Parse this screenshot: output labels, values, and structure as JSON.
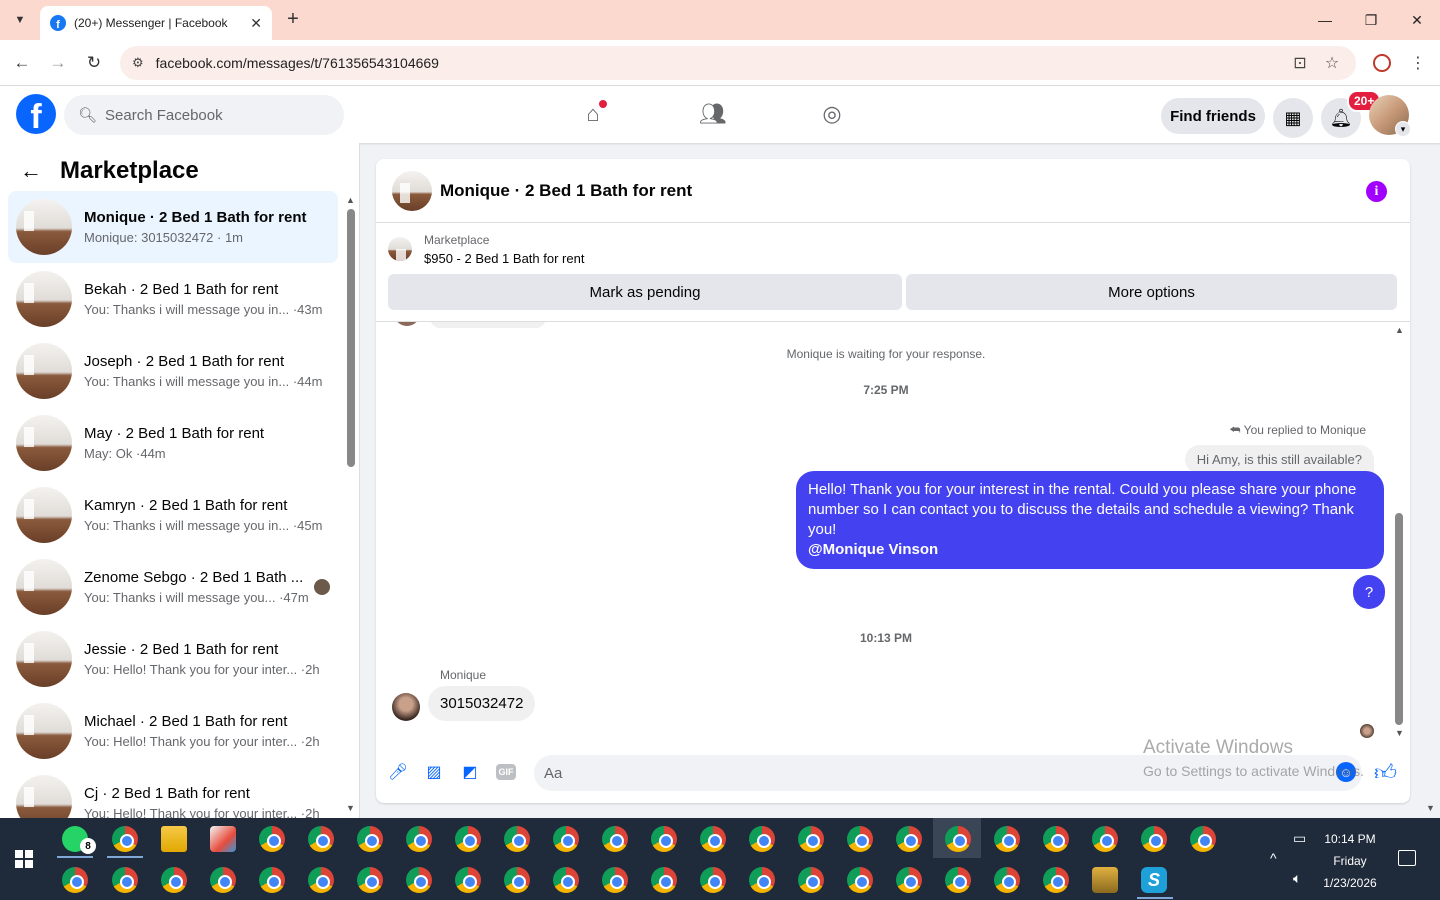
{
  "browser": {
    "tab_title": "(20+) Messenger | Facebook",
    "url": "facebook.com/messages/t/761356543104669"
  },
  "fb": {
    "search_placeholder": "Search Facebook",
    "find_friends": "Find friends",
    "notif_badge": "20+",
    "logo_letter": "f"
  },
  "sidebar": {
    "title": "Marketplace",
    "conversations": [
      {
        "name": "Monique · 2 Bed 1 Bath for rent",
        "preview": "Monique: 3015032472 · 1m"
      },
      {
        "name": "Bekah · 2 Bed 1 Bath for rent",
        "preview": "You: Thanks i will message you in... ·43m"
      },
      {
        "name": "Joseph · 2 Bed 1 Bath for rent",
        "preview": "You: Thanks i will message you in... ·44m"
      },
      {
        "name": "May · 2 Bed 1 Bath for rent",
        "preview": "May: Ok ·44m"
      },
      {
        "name": "Kamryn · 2 Bed 1 Bath for rent",
        "preview": "You: Thanks i will message you in... ·45m"
      },
      {
        "name": "Zenome Sebgo · 2 Bed 1 Bath ...",
        "preview": "You: Thanks i will message you... ·47m"
      },
      {
        "name": "Jessie · 2 Bed 1 Bath for rent",
        "preview": "You: Hello! Thank you for your inter... ·2h"
      },
      {
        "name": "Michael · 2 Bed 1 Bath for rent",
        "preview": "You: Hello! Thank you for your inter... ·2h"
      },
      {
        "name": "Cj · 2 Bed 1 Bath for rent",
        "preview": "You: Hello! Thank you for your inter... ·2h"
      }
    ]
  },
  "chat": {
    "title": "Monique · 2 Bed 1 Bath for rent",
    "listing_label": "Marketplace",
    "listing_title": "$950 - 2 Bed 1 Bath for rent",
    "mark_pending": "Mark as pending",
    "more_options": "More options",
    "waiting_text": "Monique is waiting for your response.",
    "time1": "7:25 PM",
    "replied_to": "You replied to Monique",
    "quoted": "Hi Amy, is this still available?",
    "outgoing_text": "Hello! Thank you for your interest in the rental. Could you please share your phone number so I can contact you to discuss the details and schedule a viewing? Thank you!",
    "outgoing_mention": "@Monique Vinson",
    "question_bubble": "?",
    "time2": "10:13 PM",
    "sender": "Monique",
    "incoming_text": "3015032472",
    "composer_placeholder": "Aa"
  },
  "watermark": {
    "line1": "Activate Windows",
    "line2": "Go to Settings to activate Windows."
  },
  "taskbar": {
    "whatsapp_badge": "8",
    "time": "10:14 PM",
    "day": "Friday",
    "date": "1/23/2026"
  }
}
